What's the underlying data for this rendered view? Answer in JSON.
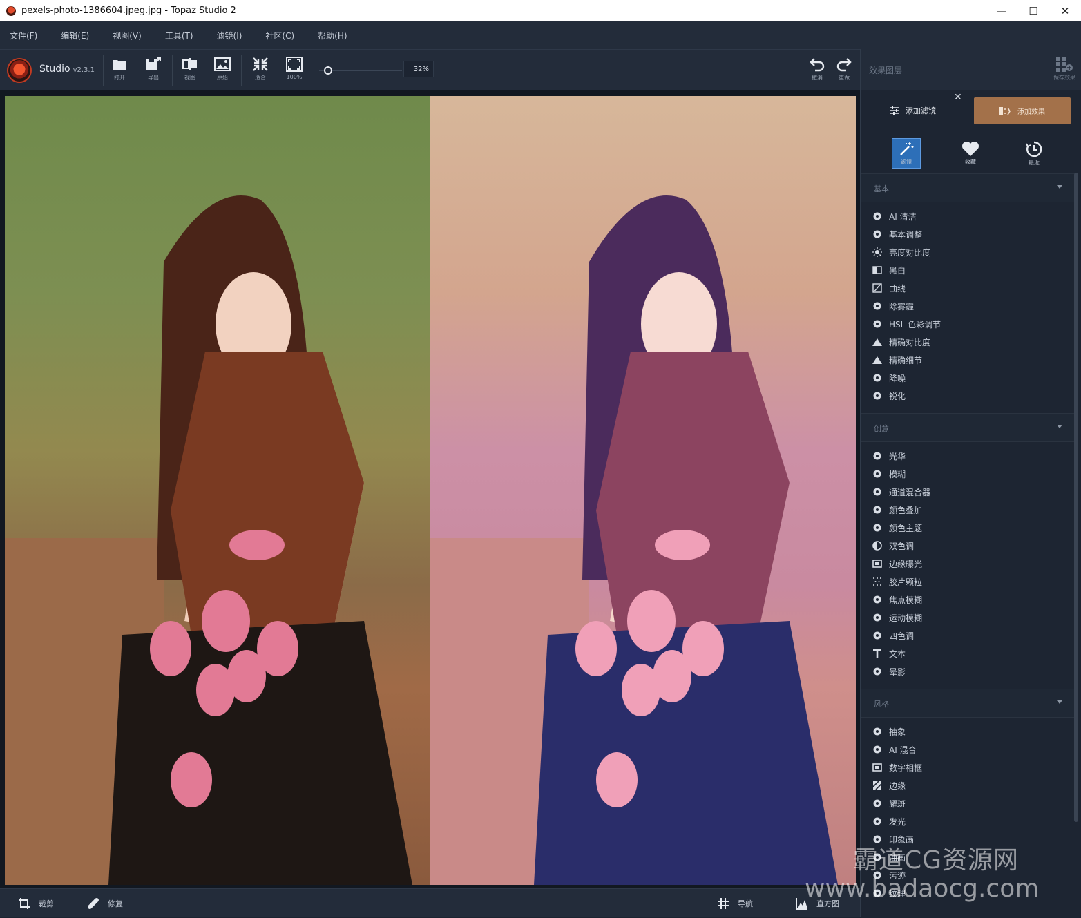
{
  "window": {
    "title": "pexels-photo-1386604.jpeg.jpg - Topaz Studio 2",
    "minimize": "—",
    "maximize": "☐",
    "close": "✕"
  },
  "menu": [
    "文件(F)",
    "编辑(E)",
    "视图(V)",
    "工具(T)",
    "滤镜(I)",
    "社区(C)",
    "帮助(H)"
  ],
  "toolbar": {
    "app_name": "Studio",
    "version": "v2.3.1",
    "open": "打开",
    "export": "导出",
    "view": "视图",
    "original": "原始",
    "fit": "适合",
    "actual": "100%",
    "zoom": "32%",
    "zoom_fraction": 0.05,
    "undo": "撤消",
    "redo": "重做"
  },
  "right_top": {
    "label": "效果图层",
    "save_effect": "保存效果"
  },
  "panel": {
    "add_filter": "添加滤镜",
    "close": "✕",
    "add_effect": "添加效果",
    "tabs": [
      {
        "label": "滤镜",
        "icon": "magic-wand-icon"
      },
      {
        "label": "收藏",
        "icon": "heart-icon"
      },
      {
        "label": "最近",
        "icon": "clock-icon"
      }
    ],
    "sections": [
      {
        "title": "基本",
        "items": [
          "AI 清洁",
          "基本调整",
          "亮度对比度",
          "黑白",
          "曲线",
          "除雾霾",
          "HSL 色彩调节",
          "精确对比度",
          "精确细节",
          "降噪",
          "锐化"
        ]
      },
      {
        "title": "创意",
        "items": [
          "光华",
          "模糊",
          "通道混合器",
          "颜色叠加",
          "颜色主题",
          "双色调",
          "边缘曝光",
          "胶片颗粒",
          "焦点模糊",
          "运动模糊",
          "四色调",
          "文本",
          "晕影"
        ]
      },
      {
        "title": "风格",
        "items": [
          "抽象",
          "AI 混合",
          "数字相框",
          "边缘",
          "耀斑",
          "发光",
          "印象画",
          "油画",
          "污迹",
          "纹理"
        ]
      }
    ]
  },
  "bottom": {
    "crop": "裁剪",
    "repair": "修复",
    "navigate": "导航",
    "histogram": "直方图"
  },
  "watermark": {
    "line1": "霸道CG资源网",
    "line2": "www.badaocg.com"
  }
}
